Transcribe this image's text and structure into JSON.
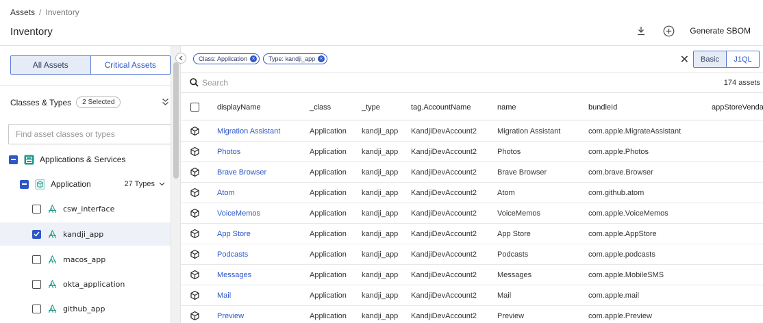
{
  "header": {
    "breadcrumb": {
      "root": "Assets",
      "separator": "/",
      "current": "Inventory"
    },
    "title": "Inventory",
    "actions": {
      "download_icon": "download-icon",
      "add_icon": "plus-circle-icon",
      "generate_label": "Generate SBOM"
    }
  },
  "sidebar": {
    "segments": {
      "all": "All Assets",
      "critical": "Critical Assets"
    },
    "classes_types": {
      "label": "Classes & Types",
      "badge": "2 Selected"
    },
    "find_placeholder": "Find asset classes or types",
    "tree": {
      "group": {
        "label": "Applications & Services",
        "state": "indeterminate"
      },
      "class": {
        "label": "Application",
        "types_count": "27 Types",
        "state": "indeterminate"
      },
      "types": [
        {
          "label": "csw_interface",
          "checked": false
        },
        {
          "label": "kandji_app",
          "checked": true
        },
        {
          "label": "macos_app",
          "checked": false
        },
        {
          "label": "okta_application",
          "checked": false
        },
        {
          "label": "github_app",
          "checked": false
        }
      ]
    }
  },
  "main": {
    "filters": [
      {
        "label": "Class: Application"
      },
      {
        "label": "Type: kandji_app"
      }
    ],
    "mode": {
      "basic": "Basic",
      "j1ql": "J1QL",
      "selected": "Basic"
    },
    "search_placeholder": "Search",
    "asset_count": "174 assets",
    "columns": [
      "displayName",
      "_class",
      "_type",
      "tag.AccountName",
      "name",
      "bundleId",
      "appStoreVendal"
    ],
    "rows": [
      [
        "Migration Assistant",
        "Application",
        "kandji_app",
        "KandjiDevAccount2",
        "Migration Assistant",
        "com.apple.MigrateAssistant"
      ],
      [
        "Photos",
        "Application",
        "kandji_app",
        "KandjiDevAccount2",
        "Photos",
        "com.apple.Photos"
      ],
      [
        "Brave Browser",
        "Application",
        "kandji_app",
        "KandjiDevAccount2",
        "Brave Browser",
        "com.brave.Browser"
      ],
      [
        "Atom",
        "Application",
        "kandji_app",
        "KandjiDevAccount2",
        "Atom",
        "com.github.atom"
      ],
      [
        "VoiceMemos",
        "Application",
        "kandji_app",
        "KandjiDevAccount2",
        "VoiceMemos",
        "com.apple.VoiceMemos"
      ],
      [
        "App Store",
        "Application",
        "kandji_app",
        "KandjiDevAccount2",
        "App Store",
        "com.apple.AppStore"
      ],
      [
        "Podcasts",
        "Application",
        "kandji_app",
        "KandjiDevAccount2",
        "Podcasts",
        "com.apple.podcasts"
      ],
      [
        "Messages",
        "Application",
        "kandji_app",
        "KandjiDevAccount2",
        "Messages",
        "com.apple.MobileSMS"
      ],
      [
        "Mail",
        "Application",
        "kandji_app",
        "KandjiDevAccount2",
        "Mail",
        "com.apple.mail"
      ],
      [
        "Preview",
        "Application",
        "kandji_app",
        "KandjiDevAccount2",
        "Preview",
        "com.apple.Preview"
      ]
    ]
  },
  "colors": {
    "accent": "#2d56c8",
    "selected_bg": "#e6ebf8",
    "teal_icon": "#1c9a8c"
  }
}
